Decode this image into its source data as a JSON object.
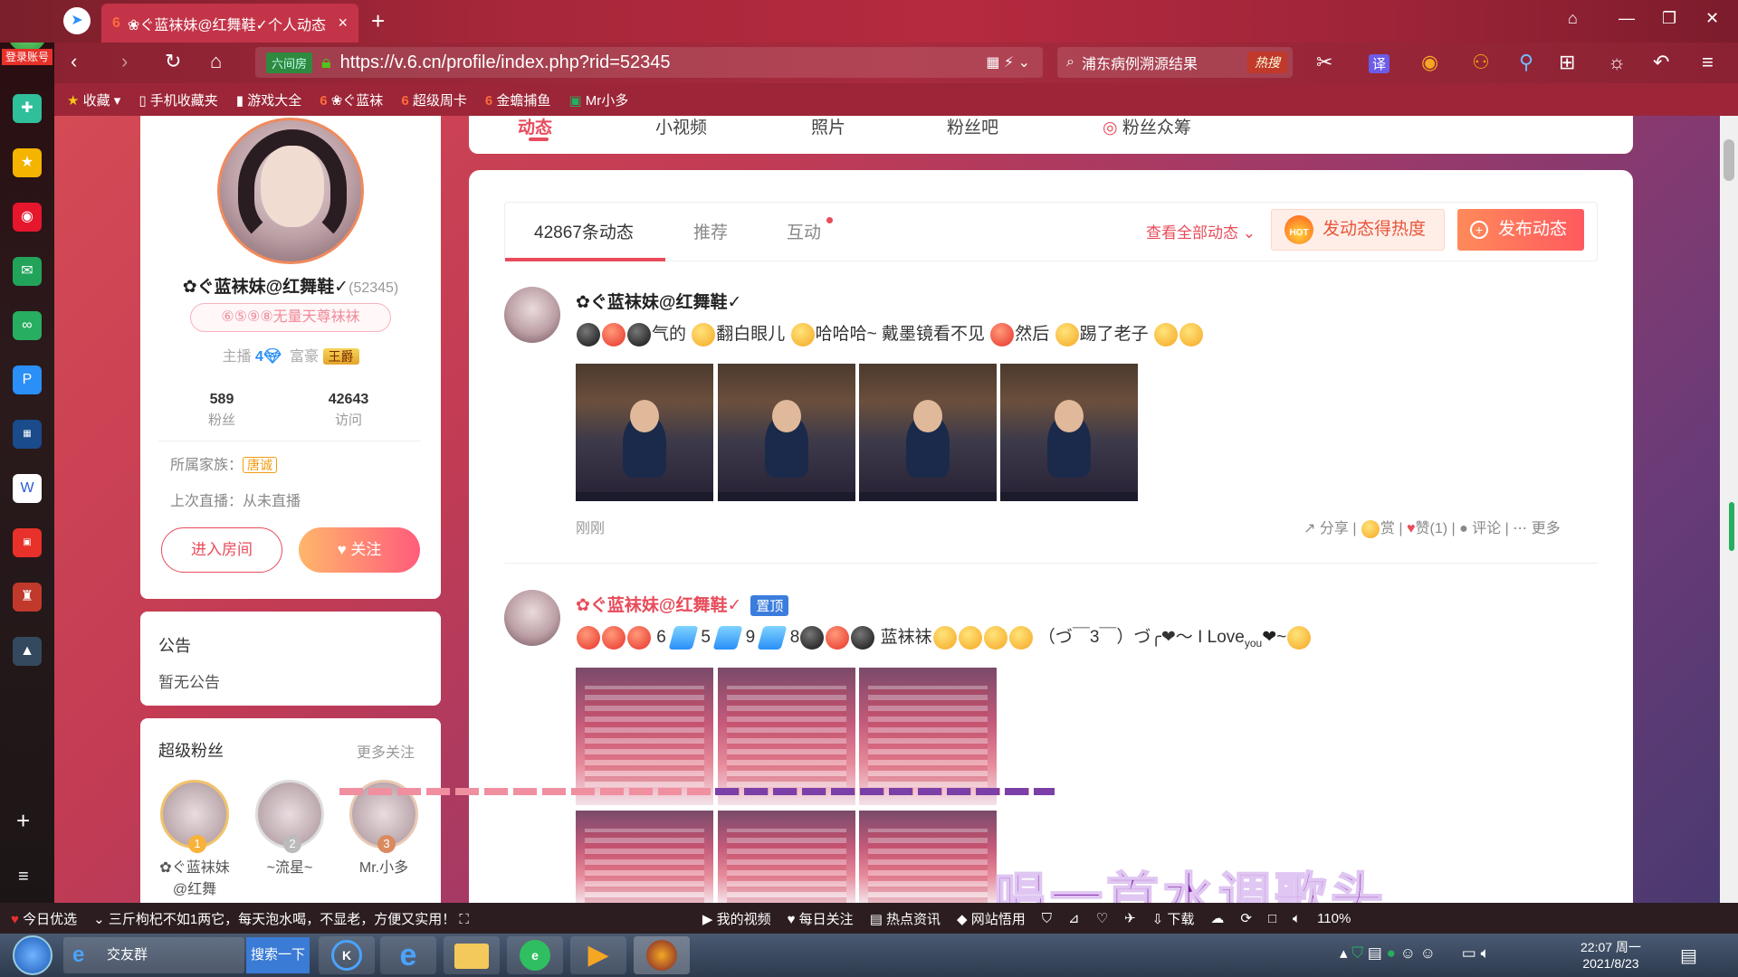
{
  "browser": {
    "tab_title": "❀ぐ蓝袜妹@红舞鞋✓个人动态",
    "tab_close": "×",
    "new_tab": "+",
    "url": "https://v.6.cn/profile/index.php?rid=52345",
    "url_badge": "六间房",
    "search_text": "浦东病例溯源结果",
    "search_hot": "热搜",
    "login_label": "登录账号",
    "bookmarks": [
      "收藏",
      "手机收藏夹",
      "游戏大全",
      "❀ぐ蓝袜",
      "超级周卡",
      "金蟾捕鱼",
      "Mr小多"
    ],
    "zoom": "110%"
  },
  "profile": {
    "name": "✿ぐ蓝袜妹@红舞鞋✓",
    "rid": "(52345)",
    "title_badge": "⑥⑤⑨⑧无量天尊袜袜",
    "anchor_label": "主播",
    "anchor_level": "4",
    "rich_label": "富豪",
    "rich_badge": "王爵",
    "fans_count": "589",
    "fans_label": "粉丝",
    "visits_count": "42643",
    "visits_label": "访问",
    "family_label": "所属家族：",
    "family_name": "唐诚",
    "last_live": "上次直播：从未直播",
    "enter_room": "进入房间",
    "follow": "关注"
  },
  "notice": {
    "title": "公告",
    "body": "暂无公告"
  },
  "super_fans": {
    "title": "超级粉丝",
    "more": "更多关注",
    "fans": [
      {
        "rank": "1",
        "name": "✿ぐ蓝袜妹@红舞"
      },
      {
        "rank": "2",
        "name": "~流星~"
      },
      {
        "rank": "3",
        "name": "Mr.小多"
      }
    ]
  },
  "top_tabs": [
    "动态",
    "小视频",
    "照片",
    "粉丝吧",
    "粉丝众筹"
  ],
  "feed_tabs": {
    "count": "42867条动态",
    "recommend": "推荐",
    "interact": "互动",
    "view_all": "查看全部动态",
    "hot_button": "发动态得热度",
    "hot_icon_text": "HOT",
    "post_button": "发布动态"
  },
  "posts": [
    {
      "author": "✿ぐ蓝袜妹@红舞鞋✓",
      "text_parts": [
        "气的",
        "翻白眼儿",
        "哈哈哈~ 戴墨镜看不见",
        "然后",
        "踢了老子"
      ],
      "time": "刚刚",
      "actions": {
        "share": "分享",
        "reward": "赏",
        "like": "赞(1)",
        "comment": "评论",
        "more": "更多"
      }
    },
    {
      "author": "✿ぐ蓝袜妹@红舞鞋✓",
      "pinned": "置顶",
      "text_parts": [
        "6",
        "5",
        "9",
        "8",
        "蓝袜袜",
        "（づ￣3￣）づ╭❤～ I Love",
        "you",
        "~"
      ]
    }
  ],
  "overlay": {
    "subtitle": "唱一首水调歌头"
  },
  "statusbar": {
    "today": "今日优选",
    "ad": "三斤枸杞不如1两它，每天泡水喝，不显老，方便又实用！",
    "video": "我的视频",
    "daily": "每日关注",
    "news": "热点资讯",
    "net": "网站悟用",
    "download": "下载"
  },
  "taskbar": {
    "group": "交友群",
    "search": "搜索一下",
    "time": "22:07 周一",
    "date": "2021/8/23"
  }
}
